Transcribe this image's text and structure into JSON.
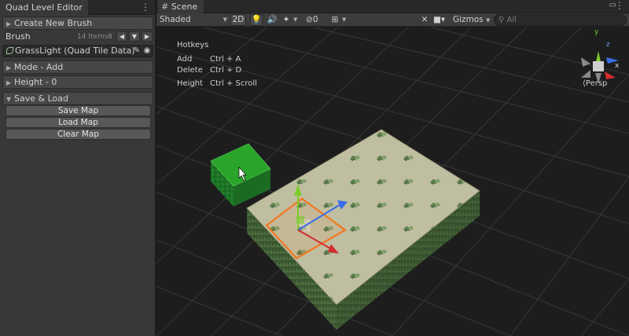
{
  "left_panel": {
    "title": "Quad Level Editor",
    "create_brush": "Create New Brush",
    "brush_label": "Brush",
    "brush_count": "14 Items",
    "brush_nav": [
      "8",
      "◀",
      "▼",
      "▶"
    ],
    "brush_value": "GrassLight (Quad Tile Data)",
    "mode": "Mode - Add",
    "height": "Height - 0",
    "save_load": "Save & Load",
    "buttons": [
      "Save Map",
      "Load Map",
      "Clear Map"
    ]
  },
  "scene": {
    "tab": "Scene",
    "shading": "Shaded",
    "mode_2d": "2D",
    "hidden_count": "0",
    "gizmos": "Gizmos",
    "search_placeholder": "All",
    "persp_label": "Persp",
    "axes": [
      "y",
      "x",
      "z"
    ],
    "hotkeys": {
      "title": "Hotkeys",
      "rows": [
        {
          "action": "Add",
          "keys": "Ctrl + A"
        },
        {
          "action": "Delete",
          "keys": "Ctrl + D"
        },
        {
          "action": "Height",
          "keys": "Ctrl + Scroll"
        }
      ]
    }
  },
  "colors": {
    "background": "#1d1d1d",
    "panel": "#383838",
    "tile_top": "#c0bea1",
    "tile_side": "#3f5c32",
    "brush_preview": "#2aa52a",
    "selection": "#f07820",
    "axis_x": "#d22b2b",
    "axis_y": "#7ccc28",
    "axis_z": "#3a6ee8"
  }
}
